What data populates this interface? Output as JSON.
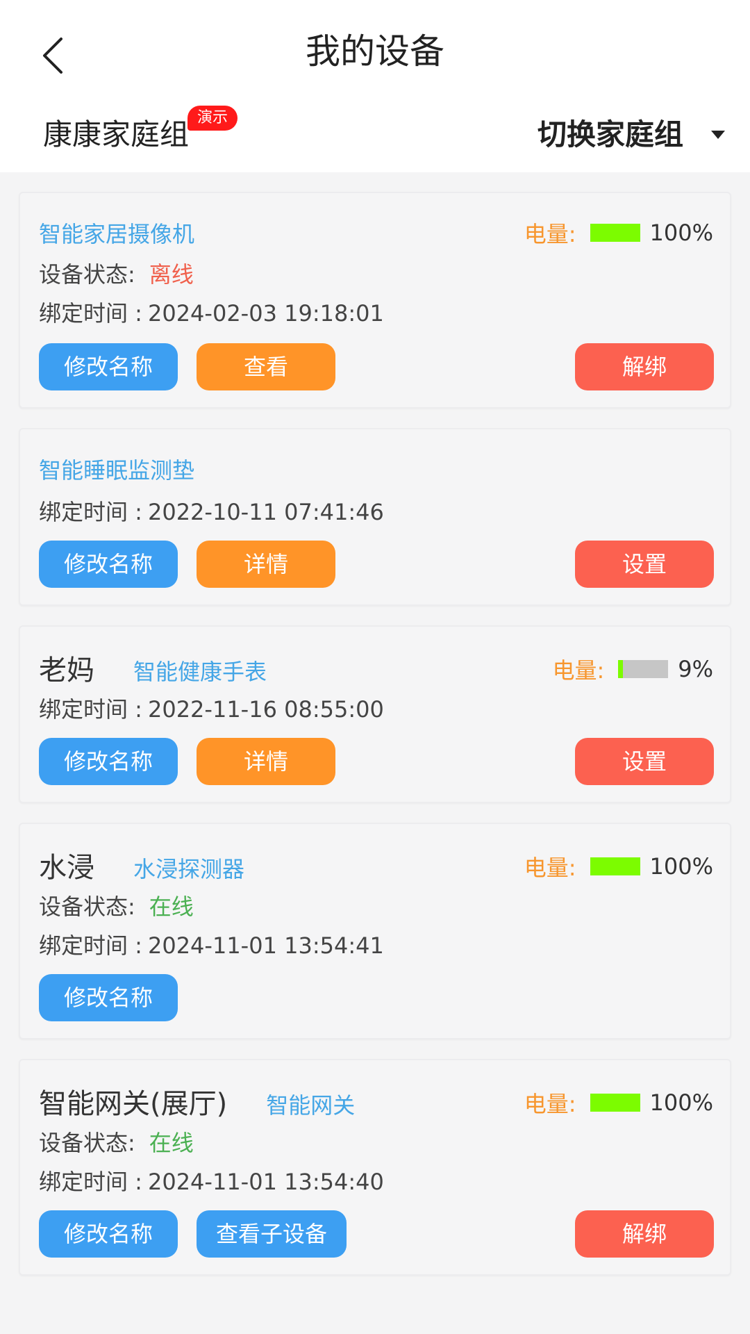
{
  "header": {
    "title": "我的设备",
    "group_name": "康康家庭组",
    "demo_badge": "演示",
    "switch_label": "切换家庭组"
  },
  "labels": {
    "battery": "电量:",
    "status": "设备状态:",
    "bind_time": "绑定时间 :"
  },
  "devices": [
    {
      "name": "",
      "type": "智能家居摄像机",
      "battery": "100%",
      "battery_level": 1.0,
      "status": "离线",
      "bind_time": "2024-02-03 19:18:01",
      "buttons": [
        "修改名称",
        "查看",
        "解绑"
      ]
    },
    {
      "name": "",
      "type": "智能睡眠监测垫",
      "bind_time": "2022-10-11 07:41:46",
      "buttons": [
        "修改名称",
        "详情",
        "设置"
      ]
    },
    {
      "name": "老妈",
      "type": "智能健康手表",
      "battery": "9%",
      "battery_level": 0.09,
      "bind_time": "2022-11-16 08:55:00",
      "buttons": [
        "修改名称",
        "详情",
        "设置"
      ]
    },
    {
      "name": "水浸",
      "type": "水浸探测器",
      "battery": "100%",
      "battery_level": 1.0,
      "status": "在线",
      "bind_time": "2024-11-01 13:54:41",
      "buttons": [
        "修改名称"
      ]
    },
    {
      "name": "智能网关(展厅)",
      "type": "智能网关",
      "battery": "100%",
      "battery_level": 1.0,
      "status": "在线",
      "bind_time": "2024-11-01 13:54:40",
      "buttons": [
        "修改名称",
        "查看子设备",
        "解绑"
      ]
    }
  ],
  "colors": {
    "blue_button": "#3d9ff2",
    "orange_button": "#ff9428",
    "red_button": "#fc6150",
    "device_type": "#45a6e6",
    "battery_label": "#f7962e",
    "battery_full": "#7cfc00",
    "offline": "#f0604c",
    "online": "#4bb052",
    "badge": "#ff1a1a"
  },
  "icons": {
    "back": "chevron-left-icon",
    "dropdown": "caret-down-icon"
  }
}
